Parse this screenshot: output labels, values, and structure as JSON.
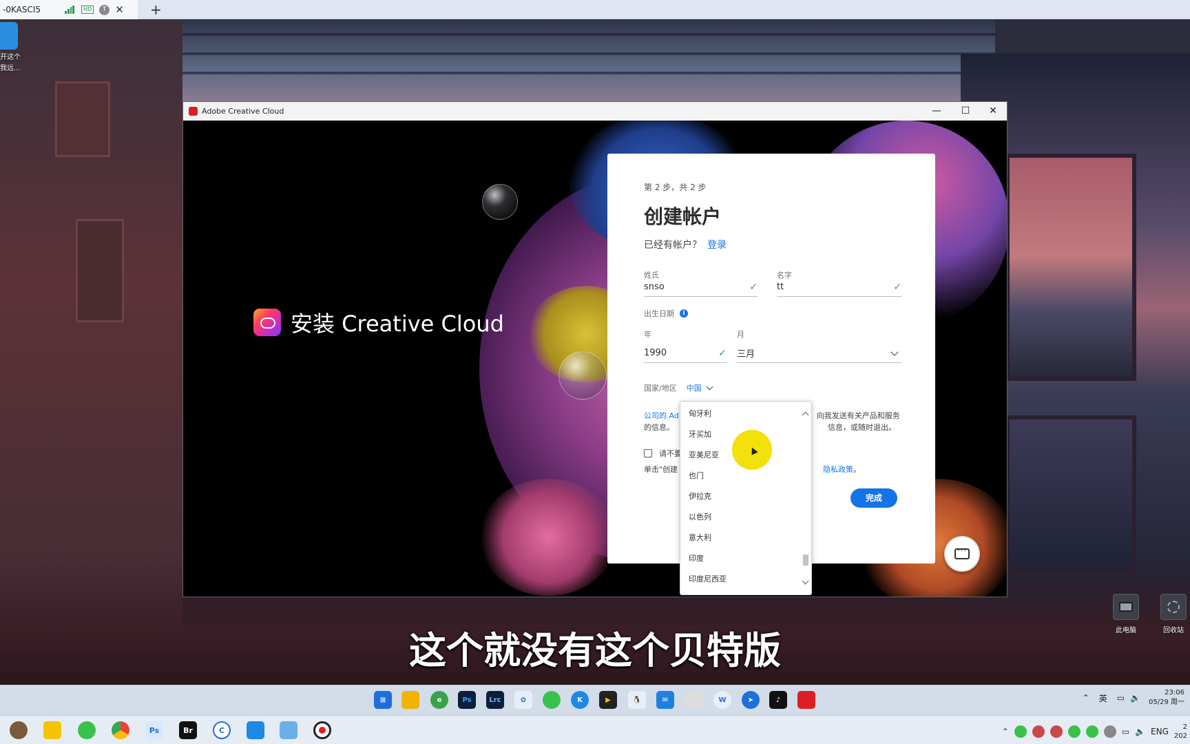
{
  "tab": {
    "title": "-0KASCI5",
    "badge_hd": "HD",
    "badge_t": "T",
    "close": "✕",
    "new_tab": "+"
  },
  "desktop": {
    "shortcut_label_1": "开这个",
    "shortcut_label_2": "我远...",
    "this_pc": "此电脑",
    "recycle_bin": "回收站"
  },
  "window": {
    "title": "Adobe Creative Cloud",
    "minimize": "—",
    "maximize": "☐",
    "close": "✕"
  },
  "brand": {
    "text": "安装 Creative Cloud"
  },
  "signup": {
    "step": "第 2 步，共 2 步",
    "heading": "创建帐户",
    "have_account": "已经有帐户？",
    "login_link": "登录",
    "last_name_label": "姓氏",
    "last_name_value": "snso",
    "first_name_label": "名字",
    "first_name_value": "tt",
    "dob_label": "出生日期",
    "info_icon": "i",
    "year_label": "年",
    "year_value": "1990",
    "month_label": "月",
    "month_value": "三月",
    "country_label": "国家/地区",
    "country_value": "中国",
    "consent_line1_a": "公司的 Ad",
    "consent_line1_b": "向我发送有关产品和服务",
    "consent_line2_a": "的信息。",
    "consent_line2_b": "信息，或随时退出。",
    "opt_out_text": "请不要",
    "terms_a": "单击\"创建",
    "terms_link": "隐私政策",
    "terms_end": "。",
    "done_button": "完成"
  },
  "country_dropdown": {
    "options": [
      "匈牙利",
      "牙买加",
      "亚美尼亚",
      "也门",
      "伊拉克",
      "以色列",
      "意大利",
      "印度",
      "印度尼西亚"
    ]
  },
  "subtitle": "这个就没有这个贝特版",
  "inner_tray": {
    "ime": "英",
    "time": "23:06",
    "date": "05/29 周一"
  },
  "outer_tray": {
    "lang": "ENG",
    "time_fragment": "2",
    "date_fragment": "202"
  },
  "colors": {
    "accent_blue": "#1473e6",
    "check_green": "#2d9d78",
    "cursor_highlight": "#f2e10a"
  }
}
